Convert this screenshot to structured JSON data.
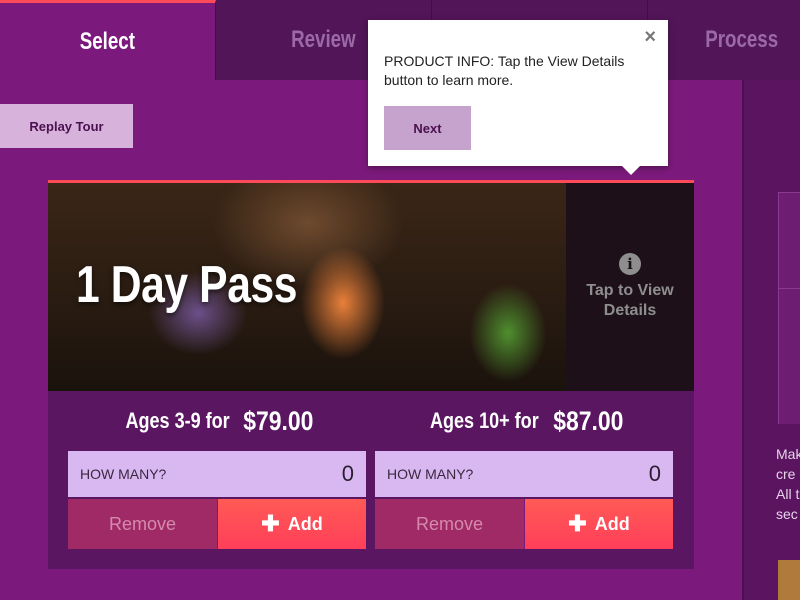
{
  "tabs": [
    {
      "label": "Select",
      "active": true
    },
    {
      "label": "Review",
      "active": false
    },
    {
      "label": "",
      "active": false
    },
    {
      "label": "Process",
      "active": false
    }
  ],
  "replay_tour": "Replay Tour",
  "tooltip": {
    "message": "PRODUCT INFO: Tap the View Details button to learn more.",
    "next_label": "Next",
    "close_symbol": "×"
  },
  "product": {
    "title": "1 Day Pass",
    "details_icon": "i",
    "details_label": "Tap to View Details",
    "tiers": [
      {
        "age_label": "Ages 3-9 for",
        "price": "$79.00",
        "howmany_label": "HOW MANY?",
        "quantity": "0",
        "remove_label": "Remove",
        "add_label": "Add"
      },
      {
        "age_label": "Ages 10+ for",
        "price": "$87.00",
        "howmany_label": "HOW MANY?",
        "quantity": "0",
        "remove_label": "Remove",
        "add_label": "Add"
      }
    ]
  },
  "sidebar_text": [
    "Mak",
    "cre",
    "All t",
    "sec"
  ],
  "colors": {
    "background": "#7b1a7c",
    "accent": "#ff4a5a",
    "card": "#5a1660",
    "quantity_field": "#d9b8f2"
  }
}
